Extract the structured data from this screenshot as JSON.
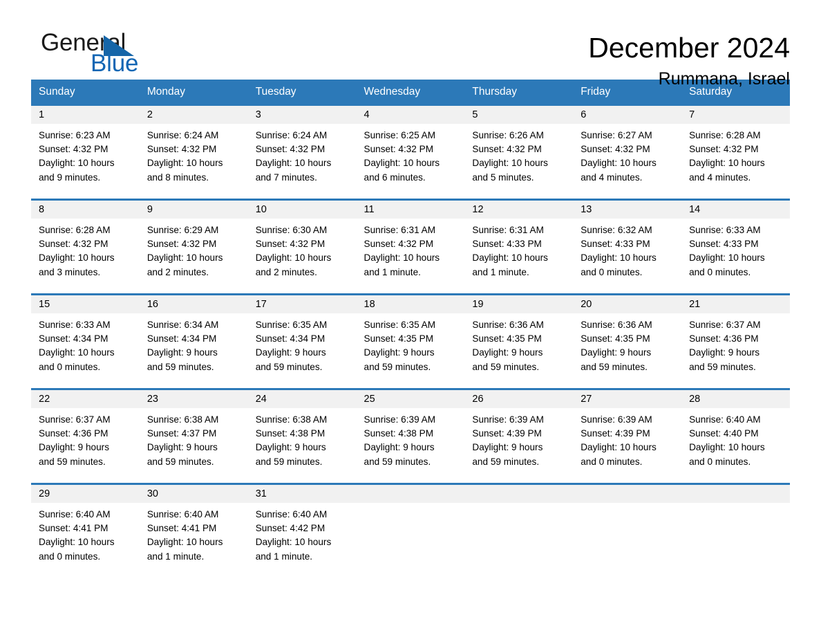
{
  "logo": {
    "text_general": "General",
    "text_blue": "Blue",
    "triangle_color": "#1565a8",
    "blue_text_color": "#1266b4"
  },
  "header": {
    "title": "December 2024",
    "subtitle": "Rummana, Israel"
  },
  "theme": {
    "header_blue": "#2c79b8",
    "row_border_blue": "#2c79b8",
    "daynum_band_gray": "#f1f1f1",
    "page_background": "#ffffff",
    "text_color": "#000000"
  },
  "calendar": {
    "weekday_headers": [
      "Sunday",
      "Monday",
      "Tuesday",
      "Wednesday",
      "Thursday",
      "Friday",
      "Saturday"
    ],
    "weeks": [
      [
        {
          "day": "1",
          "sunrise": "Sunrise: 6:23 AM",
          "sunset": "Sunset: 4:32 PM",
          "daylight_line1": "Daylight: 10 hours",
          "daylight_line2": "and 9 minutes."
        },
        {
          "day": "2",
          "sunrise": "Sunrise: 6:24 AM",
          "sunset": "Sunset: 4:32 PM",
          "daylight_line1": "Daylight: 10 hours",
          "daylight_line2": "and 8 minutes."
        },
        {
          "day": "3",
          "sunrise": "Sunrise: 6:24 AM",
          "sunset": "Sunset: 4:32 PM",
          "daylight_line1": "Daylight: 10 hours",
          "daylight_line2": "and 7 minutes."
        },
        {
          "day": "4",
          "sunrise": "Sunrise: 6:25 AM",
          "sunset": "Sunset: 4:32 PM",
          "daylight_line1": "Daylight: 10 hours",
          "daylight_line2": "and 6 minutes."
        },
        {
          "day": "5",
          "sunrise": "Sunrise: 6:26 AM",
          "sunset": "Sunset: 4:32 PM",
          "daylight_line1": "Daylight: 10 hours",
          "daylight_line2": "and 5 minutes."
        },
        {
          "day": "6",
          "sunrise": "Sunrise: 6:27 AM",
          "sunset": "Sunset: 4:32 PM",
          "daylight_line1": "Daylight: 10 hours",
          "daylight_line2": "and 4 minutes."
        },
        {
          "day": "7",
          "sunrise": "Sunrise: 6:28 AM",
          "sunset": "Sunset: 4:32 PM",
          "daylight_line1": "Daylight: 10 hours",
          "daylight_line2": "and 4 minutes."
        }
      ],
      [
        {
          "day": "8",
          "sunrise": "Sunrise: 6:28 AM",
          "sunset": "Sunset: 4:32 PM",
          "daylight_line1": "Daylight: 10 hours",
          "daylight_line2": "and 3 minutes."
        },
        {
          "day": "9",
          "sunrise": "Sunrise: 6:29 AM",
          "sunset": "Sunset: 4:32 PM",
          "daylight_line1": "Daylight: 10 hours",
          "daylight_line2": "and 2 minutes."
        },
        {
          "day": "10",
          "sunrise": "Sunrise: 6:30 AM",
          "sunset": "Sunset: 4:32 PM",
          "daylight_line1": "Daylight: 10 hours",
          "daylight_line2": "and 2 minutes."
        },
        {
          "day": "11",
          "sunrise": "Sunrise: 6:31 AM",
          "sunset": "Sunset: 4:32 PM",
          "daylight_line1": "Daylight: 10 hours",
          "daylight_line2": "and 1 minute."
        },
        {
          "day": "12",
          "sunrise": "Sunrise: 6:31 AM",
          "sunset": "Sunset: 4:33 PM",
          "daylight_line1": "Daylight: 10 hours",
          "daylight_line2": "and 1 minute."
        },
        {
          "day": "13",
          "sunrise": "Sunrise: 6:32 AM",
          "sunset": "Sunset: 4:33 PM",
          "daylight_line1": "Daylight: 10 hours",
          "daylight_line2": "and 0 minutes."
        },
        {
          "day": "14",
          "sunrise": "Sunrise: 6:33 AM",
          "sunset": "Sunset: 4:33 PM",
          "daylight_line1": "Daylight: 10 hours",
          "daylight_line2": "and 0 minutes."
        }
      ],
      [
        {
          "day": "15",
          "sunrise": "Sunrise: 6:33 AM",
          "sunset": "Sunset: 4:34 PM",
          "daylight_line1": "Daylight: 10 hours",
          "daylight_line2": "and 0 minutes."
        },
        {
          "day": "16",
          "sunrise": "Sunrise: 6:34 AM",
          "sunset": "Sunset: 4:34 PM",
          "daylight_line1": "Daylight: 9 hours",
          "daylight_line2": "and 59 minutes."
        },
        {
          "day": "17",
          "sunrise": "Sunrise: 6:35 AM",
          "sunset": "Sunset: 4:34 PM",
          "daylight_line1": "Daylight: 9 hours",
          "daylight_line2": "and 59 minutes."
        },
        {
          "day": "18",
          "sunrise": "Sunrise: 6:35 AM",
          "sunset": "Sunset: 4:35 PM",
          "daylight_line1": "Daylight: 9 hours",
          "daylight_line2": "and 59 minutes."
        },
        {
          "day": "19",
          "sunrise": "Sunrise: 6:36 AM",
          "sunset": "Sunset: 4:35 PM",
          "daylight_line1": "Daylight: 9 hours",
          "daylight_line2": "and 59 minutes."
        },
        {
          "day": "20",
          "sunrise": "Sunrise: 6:36 AM",
          "sunset": "Sunset: 4:35 PM",
          "daylight_line1": "Daylight: 9 hours",
          "daylight_line2": "and 59 minutes."
        },
        {
          "day": "21",
          "sunrise": "Sunrise: 6:37 AM",
          "sunset": "Sunset: 4:36 PM",
          "daylight_line1": "Daylight: 9 hours",
          "daylight_line2": "and 59 minutes."
        }
      ],
      [
        {
          "day": "22",
          "sunrise": "Sunrise: 6:37 AM",
          "sunset": "Sunset: 4:36 PM",
          "daylight_line1": "Daylight: 9 hours",
          "daylight_line2": "and 59 minutes."
        },
        {
          "day": "23",
          "sunrise": "Sunrise: 6:38 AM",
          "sunset": "Sunset: 4:37 PM",
          "daylight_line1": "Daylight: 9 hours",
          "daylight_line2": "and 59 minutes."
        },
        {
          "day": "24",
          "sunrise": "Sunrise: 6:38 AM",
          "sunset": "Sunset: 4:38 PM",
          "daylight_line1": "Daylight: 9 hours",
          "daylight_line2": "and 59 minutes."
        },
        {
          "day": "25",
          "sunrise": "Sunrise: 6:39 AM",
          "sunset": "Sunset: 4:38 PM",
          "daylight_line1": "Daylight: 9 hours",
          "daylight_line2": "and 59 minutes."
        },
        {
          "day": "26",
          "sunrise": "Sunrise: 6:39 AM",
          "sunset": "Sunset: 4:39 PM",
          "daylight_line1": "Daylight: 9 hours",
          "daylight_line2": "and 59 minutes."
        },
        {
          "day": "27",
          "sunrise": "Sunrise: 6:39 AM",
          "sunset": "Sunset: 4:39 PM",
          "daylight_line1": "Daylight: 10 hours",
          "daylight_line2": "and 0 minutes."
        },
        {
          "day": "28",
          "sunrise": "Sunrise: 6:40 AM",
          "sunset": "Sunset: 4:40 PM",
          "daylight_line1": "Daylight: 10 hours",
          "daylight_line2": "and 0 minutes."
        }
      ],
      [
        {
          "day": "29",
          "sunrise": "Sunrise: 6:40 AM",
          "sunset": "Sunset: 4:41 PM",
          "daylight_line1": "Daylight: 10 hours",
          "daylight_line2": "and 0 minutes."
        },
        {
          "day": "30",
          "sunrise": "Sunrise: 6:40 AM",
          "sunset": "Sunset: 4:41 PM",
          "daylight_line1": "Daylight: 10 hours",
          "daylight_line2": "and 1 minute."
        },
        {
          "day": "31",
          "sunrise": "Sunrise: 6:40 AM",
          "sunset": "Sunset: 4:42 PM",
          "daylight_line1": "Daylight: 10 hours",
          "daylight_line2": "and 1 minute."
        },
        {
          "day": "",
          "sunrise": "",
          "sunset": "",
          "daylight_line1": "",
          "daylight_line2": ""
        },
        {
          "day": "",
          "sunrise": "",
          "sunset": "",
          "daylight_line1": "",
          "daylight_line2": ""
        },
        {
          "day": "",
          "sunrise": "",
          "sunset": "",
          "daylight_line1": "",
          "daylight_line2": ""
        },
        {
          "day": "",
          "sunrise": "",
          "sunset": "",
          "daylight_line1": "",
          "daylight_line2": ""
        }
      ]
    ]
  }
}
